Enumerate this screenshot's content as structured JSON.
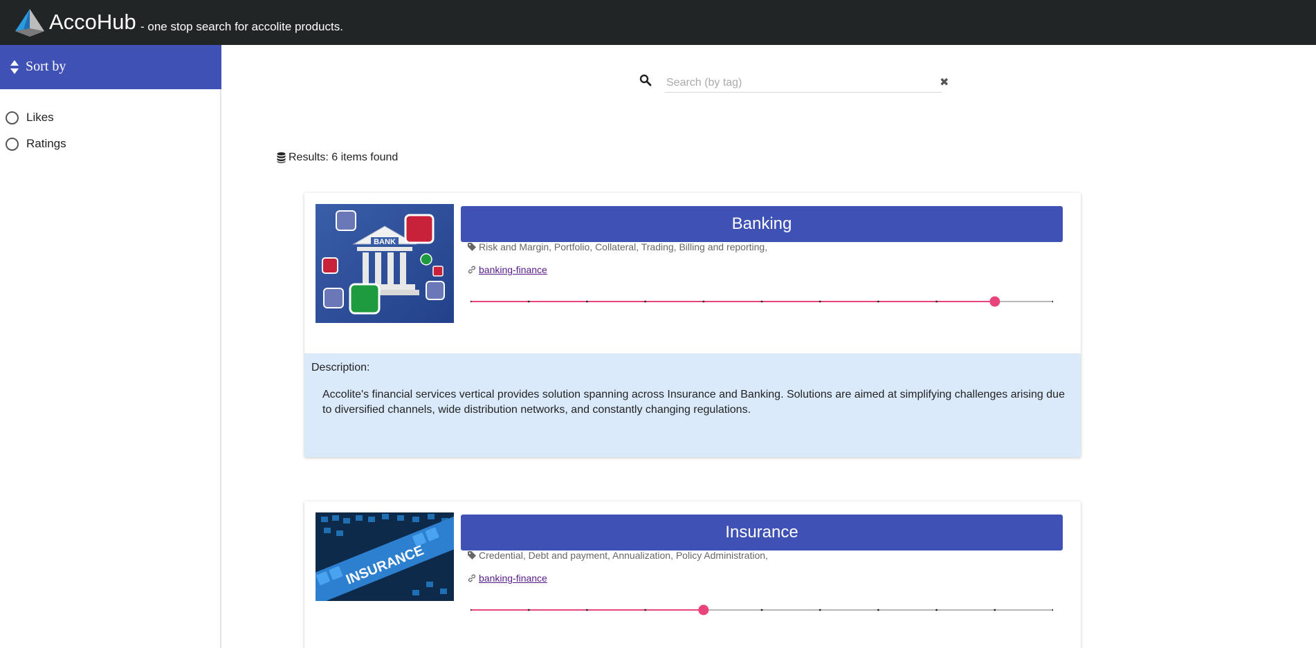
{
  "header": {
    "brand": "AccoHub",
    "tagline": "- one stop search for accolite products."
  },
  "sidebar": {
    "title": "Sort by",
    "options": [
      {
        "label": "Likes",
        "selected": false
      },
      {
        "label": "Ratings",
        "selected": false
      }
    ]
  },
  "search": {
    "placeholder": "Search (by tag)",
    "value": ""
  },
  "results": {
    "label": "Results: 6 items found"
  },
  "cards": [
    {
      "title": "Banking",
      "image_icon": "bank-illustration",
      "tags": "Risk and Margin, Portfolio, Collateral, Trading, Billing and reporting,",
      "link": "banking-finance",
      "rating_fraction": 0.9,
      "description_label": "Description:",
      "description": "Accolite's financial services vertical provides solution spanning across Insurance and Banking. Solutions are aimed at simplifying challenges arising due to diversified channels, wide distribution networks, and constantly changing regulations."
    },
    {
      "title": "Insurance",
      "image_icon": "insurance-illustration",
      "image_text": "INSURANCE",
      "tags": "Credential, Debt and payment, Annualization, Policy Administration,",
      "link": "banking-finance",
      "rating_fraction": 0.4
    }
  ],
  "colors": {
    "topbar": "#222526",
    "accent": "#3f51b5",
    "slider": "#e8437a",
    "description_bg": "#daeafb"
  }
}
